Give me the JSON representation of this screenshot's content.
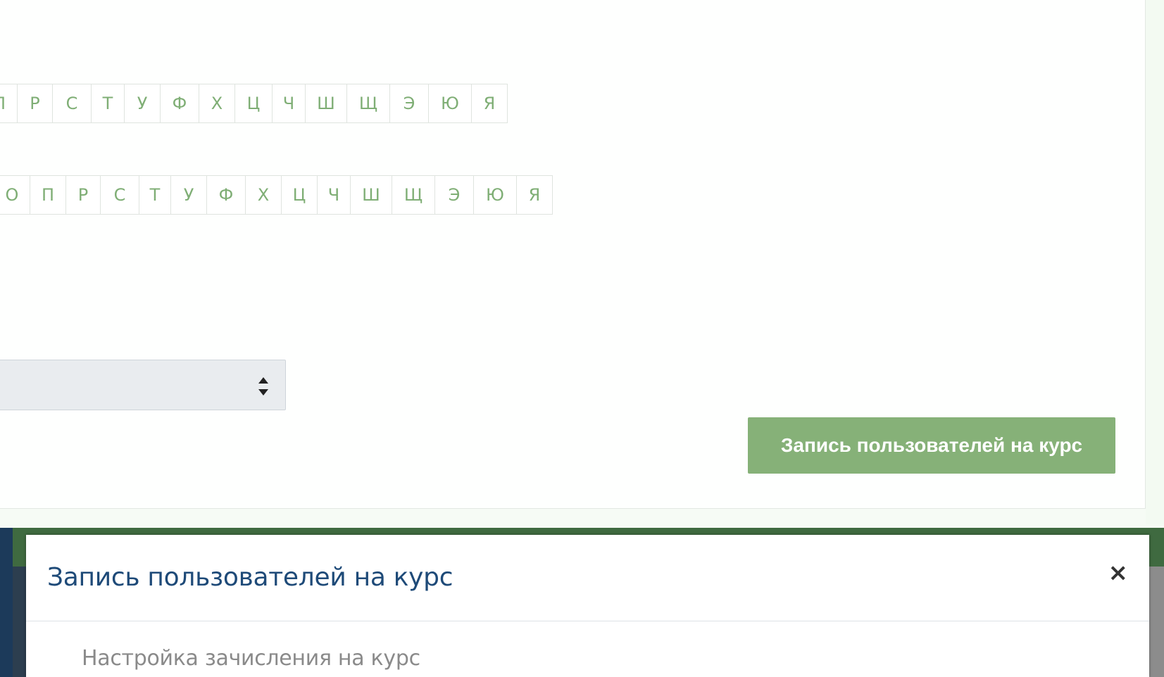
{
  "alphabet_rows": [
    {
      "letters": [
        "П",
        "Р",
        "С",
        "Т",
        "У",
        "Ф",
        "Х",
        "Ц",
        "Ч",
        "Ш",
        "Щ",
        "Э",
        "Ю",
        "Я"
      ]
    },
    {
      "letters": [
        "О",
        "П",
        "Р",
        "С",
        "Т",
        "У",
        "Ф",
        "Х",
        "Ц",
        "Ч",
        "Ш",
        "Щ",
        "Э",
        "Ю",
        "Я"
      ]
    }
  ],
  "enrol_button_label": "Запись пользователей на курс",
  "behind_modal_text": "...",
  "modal": {
    "title": "Запись пользователей на курс",
    "close_symbol": "×",
    "subtitle": "Настройка зачисления на курс"
  },
  "colors": {
    "accent_green": "#86b178",
    "letter_green": "#7fae75",
    "modal_title_blue": "#1e4a78"
  }
}
